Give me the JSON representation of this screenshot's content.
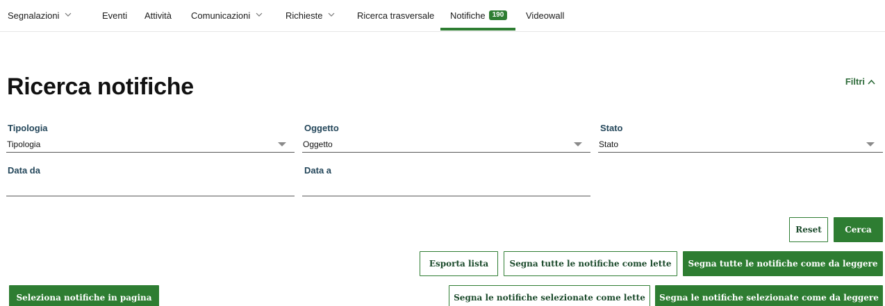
{
  "nav": {
    "items": [
      {
        "label": "Segnalazioni",
        "has_dropdown": true
      },
      {
        "label": "Eventi",
        "has_dropdown": false
      },
      {
        "label": "Attività",
        "has_dropdown": false
      },
      {
        "label": "Comunicazioni",
        "has_dropdown": true
      },
      {
        "label": "Richieste",
        "has_dropdown": true
      },
      {
        "label": "Ricerca trasversale",
        "has_dropdown": false
      },
      {
        "label": "Notifiche",
        "has_dropdown": false,
        "badge": "190",
        "active": true
      },
      {
        "label": "Videowall",
        "has_dropdown": false
      }
    ]
  },
  "page": {
    "title": "Ricerca notifiche",
    "filters_toggle": "Filtri"
  },
  "filters": {
    "tipologia": {
      "label": "Tipologia",
      "value": "Tipologia"
    },
    "oggetto": {
      "label": "Oggetto",
      "value": "Oggetto"
    },
    "stato": {
      "label": "Stato",
      "value": "Stato"
    },
    "data_da": {
      "label": "Data da",
      "value": ""
    },
    "data_a": {
      "label": "Data a",
      "value": ""
    }
  },
  "actions": {
    "reset": "Reset",
    "cerca": "Cerca",
    "esporta_lista": "Esporta lista",
    "segna_tutte_lette": "Segna tutte le notifiche come lette",
    "segna_tutte_da_leggere": "Segna tutte le notifiche come da leggere",
    "seleziona_in_pagina": "Seleziona notifiche in pagina",
    "segna_selezionate_lette": "Segna le notifiche selezionate come lette",
    "segna_selezionate_da_leggere": "Segna le notifiche selezionate come da leggere"
  },
  "colors": {
    "accent": "#2e7d32",
    "label": "#23465a"
  }
}
